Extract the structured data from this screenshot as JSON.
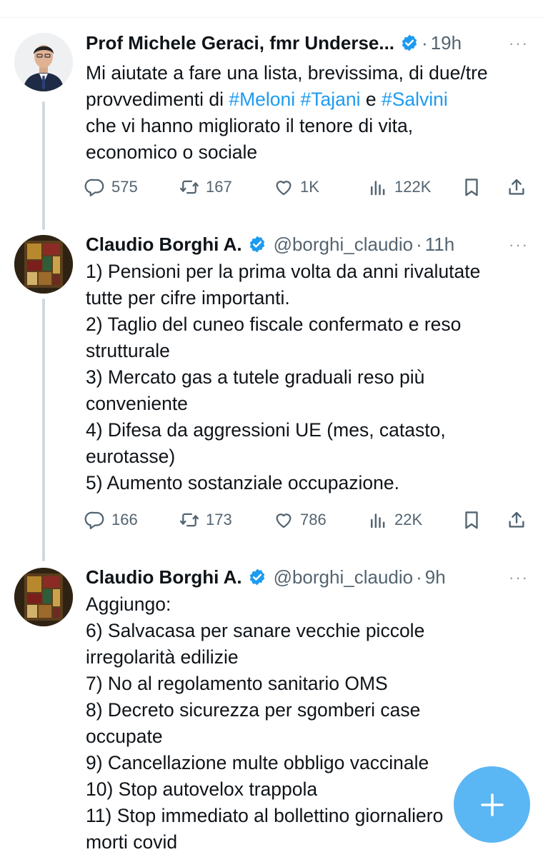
{
  "tweets": [
    {
      "author": "Prof Michele Geraci, fmr Underse...",
      "handle": "",
      "time": "19h",
      "separator": "·",
      "more": "···",
      "lines": [
        {
          "parts": [
            {
              "t": "Mi aiutate a fare una lista, brevissima, di due/tre"
            }
          ]
        },
        {
          "parts": [
            {
              "t": "provvedimenti di "
            },
            {
              "t": "#Meloni",
              "tag": true
            },
            {
              "t": " "
            },
            {
              "t": "#Tajani",
              "tag": true
            },
            {
              "t": " e "
            },
            {
              "t": "#Salvini",
              "tag": true
            }
          ]
        },
        {
          "parts": [
            {
              "t": "che vi hanno migliorato il tenore di vita,"
            }
          ]
        },
        {
          "parts": [
            {
              "t": "economico o sociale"
            }
          ]
        }
      ],
      "stats": {
        "replies": "575",
        "retweets": "167",
        "likes": "1K",
        "views": "122K"
      }
    },
    {
      "author": "Claudio Borghi A.",
      "handle": "@borghi_claudio",
      "time": "11h",
      "separator": "·",
      "more": "···",
      "lines": [
        {
          "parts": [
            {
              "t": "1) Pensioni per la prima volta da anni rivalutate"
            }
          ]
        },
        {
          "parts": [
            {
              "t": "tutte per cifre importanti."
            }
          ]
        },
        {
          "parts": [
            {
              "t": "2) Taglio del cuneo fiscale confermato e reso"
            }
          ]
        },
        {
          "parts": [
            {
              "t": "strutturale"
            }
          ]
        },
        {
          "parts": [
            {
              "t": "3) Mercato gas a tutele graduali reso più"
            }
          ]
        },
        {
          "parts": [
            {
              "t": "conveniente"
            }
          ]
        },
        {
          "parts": [
            {
              "t": "4) Difesa da aggressioni UE (mes, catasto,"
            }
          ]
        },
        {
          "parts": [
            {
              "t": "eurotasse)"
            }
          ]
        },
        {
          "parts": [
            {
              "t": "5) Aumento sostanziale occupazione."
            }
          ]
        }
      ],
      "stats": {
        "replies": "166",
        "retweets": "173",
        "likes": "786",
        "views": "22K"
      }
    },
    {
      "author": "Claudio Borghi A.",
      "handle": "@borghi_claudio",
      "time": "9h",
      "separator": "·",
      "more": "···",
      "lines": [
        {
          "parts": [
            {
              "t": "Aggiungo:"
            }
          ]
        },
        {
          "parts": [
            {
              "t": "6) Salvacasa per sanare vecchie piccole"
            }
          ]
        },
        {
          "parts": [
            {
              "t": "irregolarità edilizie"
            }
          ]
        },
        {
          "parts": [
            {
              "t": "7) No al regolamento sanitario OMS"
            }
          ]
        },
        {
          "parts": [
            {
              "t": "8) Decreto sicurezza per sgomberi case"
            }
          ]
        },
        {
          "parts": [
            {
              "t": "occupate"
            }
          ]
        },
        {
          "parts": [
            {
              "t": "9) Cancellazione multe obbligo vaccinale"
            }
          ]
        },
        {
          "parts": [
            {
              "t": "10) Stop autovelox trappola"
            }
          ]
        },
        {
          "parts": [
            {
              "t": "11) Stop immediato al bollettino giornaliero"
            }
          ]
        },
        {
          "parts": [
            {
              "t": "morti covid"
            }
          ]
        }
      ],
      "stats": null
    }
  ],
  "icons": {
    "reply": "reply-icon",
    "retweet": "retweet-icon",
    "like": "heart-icon",
    "views": "views-chart-icon",
    "bookmark": "bookmark-icon",
    "share": "share-icon",
    "verified": "verified-badge-icon",
    "compose": "plus-icon"
  },
  "colors": {
    "accent": "#1d9bf0",
    "text": "#0f1419",
    "muted": "#536471",
    "thread_line": "#cfd9de"
  }
}
